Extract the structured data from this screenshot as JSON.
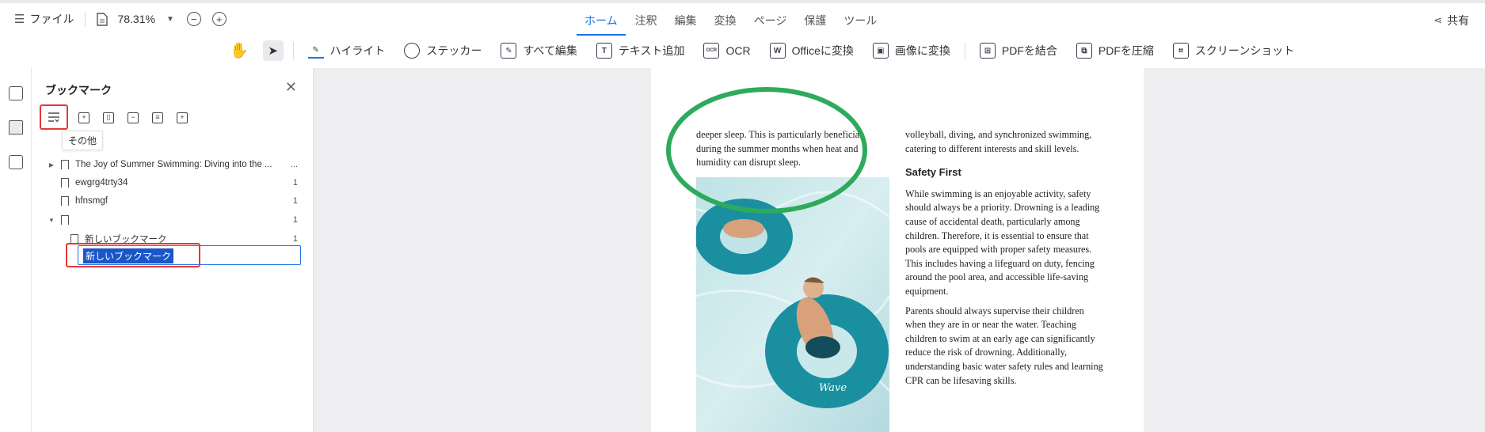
{
  "menubar": {
    "file_label": "ファイル",
    "zoom": "78.31%",
    "tabs": [
      {
        "label": "ホーム",
        "active": true
      },
      {
        "label": "注釈"
      },
      {
        "label": "編集"
      },
      {
        "label": "変換"
      },
      {
        "label": "ページ"
      },
      {
        "label": "保護"
      },
      {
        "label": "ツール"
      }
    ],
    "share_label": "共有"
  },
  "toolbar": {
    "highlight": "ハイライト",
    "sticker": "ステッカー",
    "edit_all": "すべて編集",
    "add_text": "テキスト追加",
    "ocr": "OCR",
    "to_office": "Officeに変換",
    "to_image": "画像に変換",
    "merge_pdf": "PDFを結合",
    "compress_pdf": "PDFを圧縮",
    "screenshot": "スクリーンショット"
  },
  "bookmark_panel": {
    "title": "ブックマーク",
    "tooltip": "その他",
    "items": [
      {
        "label": "The Joy of Summer Swimming: Diving into the ...",
        "page": "...",
        "expandable": true
      },
      {
        "label": "ewgrg4trty34",
        "page": "1"
      },
      {
        "label": "hfnsmgf",
        "page": "1"
      },
      {
        "label": "新しいブックマーク",
        "page": "1",
        "editing": true,
        "expanded": true
      },
      {
        "label": "新しいブックマーク",
        "page": "1",
        "child": true
      }
    ]
  },
  "document": {
    "col1_text": "deeper sleep. This is particularly beneficial during the summer months when heat and humidity can disrupt sleep.",
    "col2_intro": "volleyball, diving, and synchronized swimming, catering to different interests and skill levels.",
    "heading": "Safety First",
    "para1": "While swimming is an enjoyable activity, safety should always be a priority. Drowning is a leading cause of accidental death, particularly among children. Therefore, it is essential to ensure that pools are equipped with proper safety measures. This includes having a lifeguard on duty, fencing around the pool area, and accessible life-saving equipment.",
    "para2": "Parents should always supervise their children when they are in or near the water. Teaching children to swim at an early age can significantly reduce the risk of drowning. Additionally, understanding basic water safety rules and learning CPR can be lifesaving skills."
  },
  "colors": {
    "accent": "#1a73e8",
    "highlight_red": "#e53935",
    "ellipse_green": "#2eaa5c",
    "doc_bg": "#eeeef0"
  }
}
